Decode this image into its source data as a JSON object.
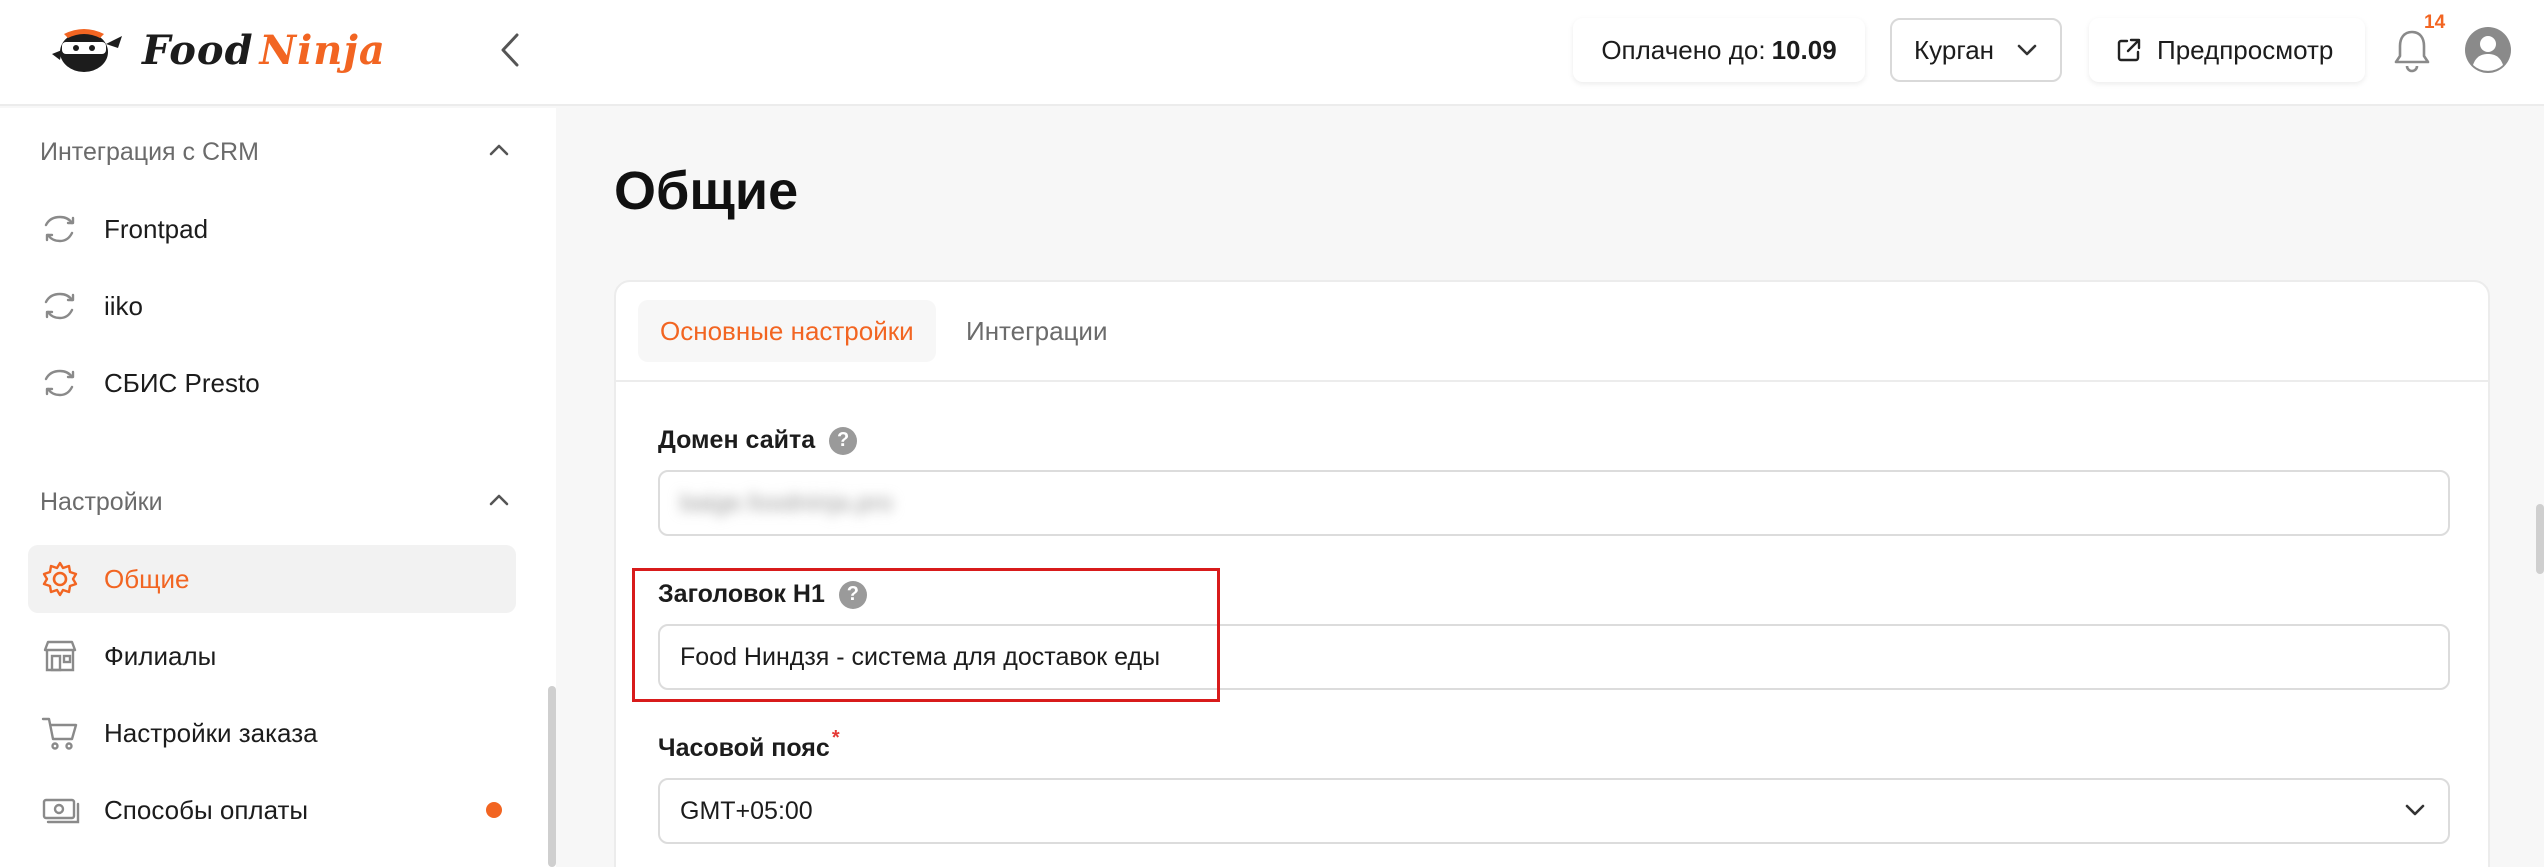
{
  "header": {
    "logo": {
      "word1": "Food",
      "word2": "Ninja"
    },
    "paid_label": "Оплачено до:",
    "paid_date": "10.09",
    "city": "Курган",
    "preview_label": "Предпросмотр",
    "notifications_count": "14"
  },
  "sidebar": {
    "sections": [
      {
        "label": "Интеграция с CRM",
        "expanded": true,
        "items": [
          {
            "label": "Frontpad",
            "icon": "sync-icon"
          },
          {
            "label": "iiko",
            "icon": "sync-icon"
          },
          {
            "label": "СБИС Presto",
            "icon": "sync-icon"
          }
        ]
      },
      {
        "label": "Настройки",
        "expanded": true,
        "items": [
          {
            "label": "Общие",
            "icon": "gear-icon",
            "active": true
          },
          {
            "label": "Филиалы",
            "icon": "store-icon"
          },
          {
            "label": "Настройки заказа",
            "icon": "cart-icon"
          },
          {
            "label": "Способы оплаты",
            "icon": "cash-icon",
            "badge_dot": true
          }
        ]
      }
    ]
  },
  "main": {
    "title": "Общие",
    "tabs": [
      {
        "label": "Основные настройки",
        "active": true
      },
      {
        "label": "Интеграции",
        "active": false
      }
    ],
    "fields": {
      "domain": {
        "label": "Домен сайта",
        "value": "baige.foodninja.pro",
        "blurred": true
      },
      "h1": {
        "label": "Заголовок H1",
        "value": "Food Ниндзя - система для доставок еды"
      },
      "timezone": {
        "label": "Часовой пояс",
        "required": true,
        "value": "GMT+05:00"
      }
    }
  },
  "colors": {
    "accent": "#f26522",
    "highlight": "#d81b1b"
  }
}
